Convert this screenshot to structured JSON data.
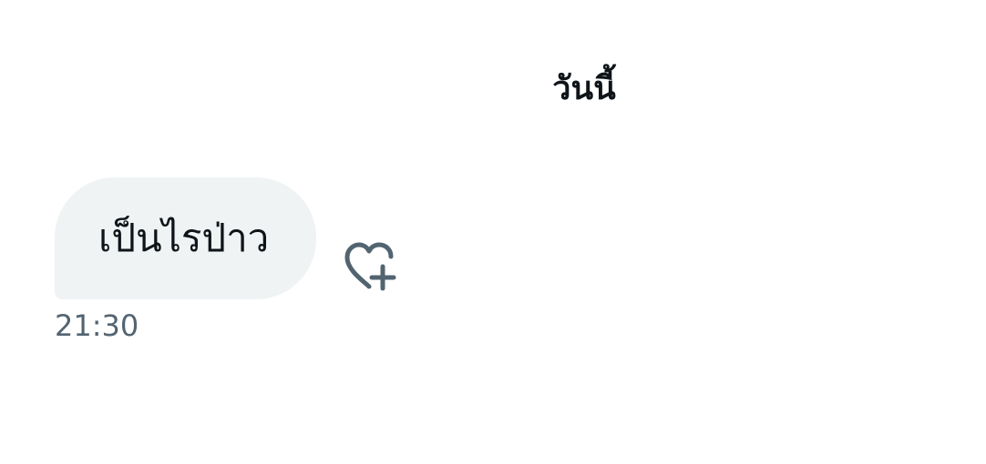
{
  "conversation": {
    "date_separator": "วันนี้",
    "messages": [
      {
        "text": "เป็นไรป่าว",
        "time": "21:30",
        "direction": "received",
        "reaction_icon": "heart-plus-icon"
      }
    ]
  },
  "colors": {
    "bubble_background": "#eff3f4",
    "primary_text": "#0f1419",
    "secondary_text": "#536471"
  }
}
